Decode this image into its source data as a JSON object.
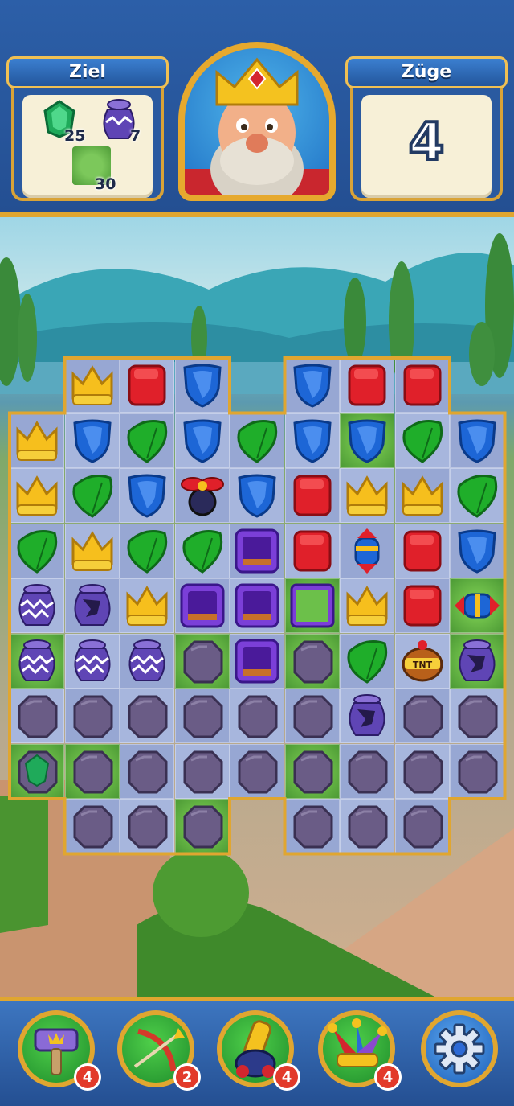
{
  "goal": {
    "title": "Ziel",
    "items": [
      {
        "icon": "emerald-icon",
        "count": "25"
      },
      {
        "icon": "vase-icon",
        "count": "7"
      },
      {
        "icon": "grass-icon",
        "count": "30"
      }
    ]
  },
  "moves": {
    "title": "Züge",
    "value": "4"
  },
  "boosters": [
    {
      "icon": "hammer-icon",
      "count": "4"
    },
    {
      "icon": "arrow-icon",
      "count": "2"
    },
    {
      "icon": "cannon-icon",
      "count": "4"
    },
    {
      "icon": "jester-hat-icon",
      "count": "4"
    }
  ],
  "colors": {
    "frame_gold": "#e0a630",
    "header_blue": "#2c5fa8",
    "shield_blue": "#1d66d6",
    "book_red": "#e0202a",
    "leaf_green": "#1fae2a",
    "crown_yellow": "#f6bf1d",
    "stone_purple": "#6a5c86",
    "vase_purple": "#5f45b5"
  },
  "board": {
    "rows": [
      [
        "void",
        "crown",
        "book",
        "shield",
        "void",
        "shield",
        "book",
        "book",
        "void"
      ],
      [
        "crown",
        "shield",
        "leaf",
        "shield",
        "leaf",
        "shield",
        "shield",
        "leaf",
        "shield"
      ],
      [
        "crown",
        "leaf",
        "shield",
        "propeller",
        "shield",
        "book",
        "crown",
        "crown",
        "leaf"
      ],
      [
        "leaf",
        "crown",
        "leaf",
        "leaf",
        "crate",
        "book",
        "rocket",
        "book",
        "shield"
      ],
      [
        "vase",
        "vase-cracked",
        "crown",
        "crate",
        "crate",
        "grass",
        "crown",
        "book",
        "rocket-h"
      ],
      [
        "vase",
        "vase",
        "vase",
        "stone",
        "crate",
        "stone",
        "leaf",
        "tnt",
        "vase-cracked"
      ],
      [
        "stone",
        "stone",
        "stone",
        "stone",
        "stone",
        "stone",
        "vase-cracked",
        "stone",
        "stone"
      ],
      [
        "emerald-stone",
        "stone",
        "stone",
        "stone",
        "stone",
        "stone",
        "stone",
        "stone",
        "stone"
      ],
      [
        "void",
        "stone",
        "stone",
        "stone",
        "void",
        "stone",
        "stone",
        "stone",
        "void"
      ]
    ],
    "grass_cells": [
      "1-6",
      "4-8",
      "4-5",
      "5-0",
      "5-3",
      "5-5",
      "5-8",
      "7-0",
      "7-1",
      "7-5",
      "8-3"
    ]
  }
}
